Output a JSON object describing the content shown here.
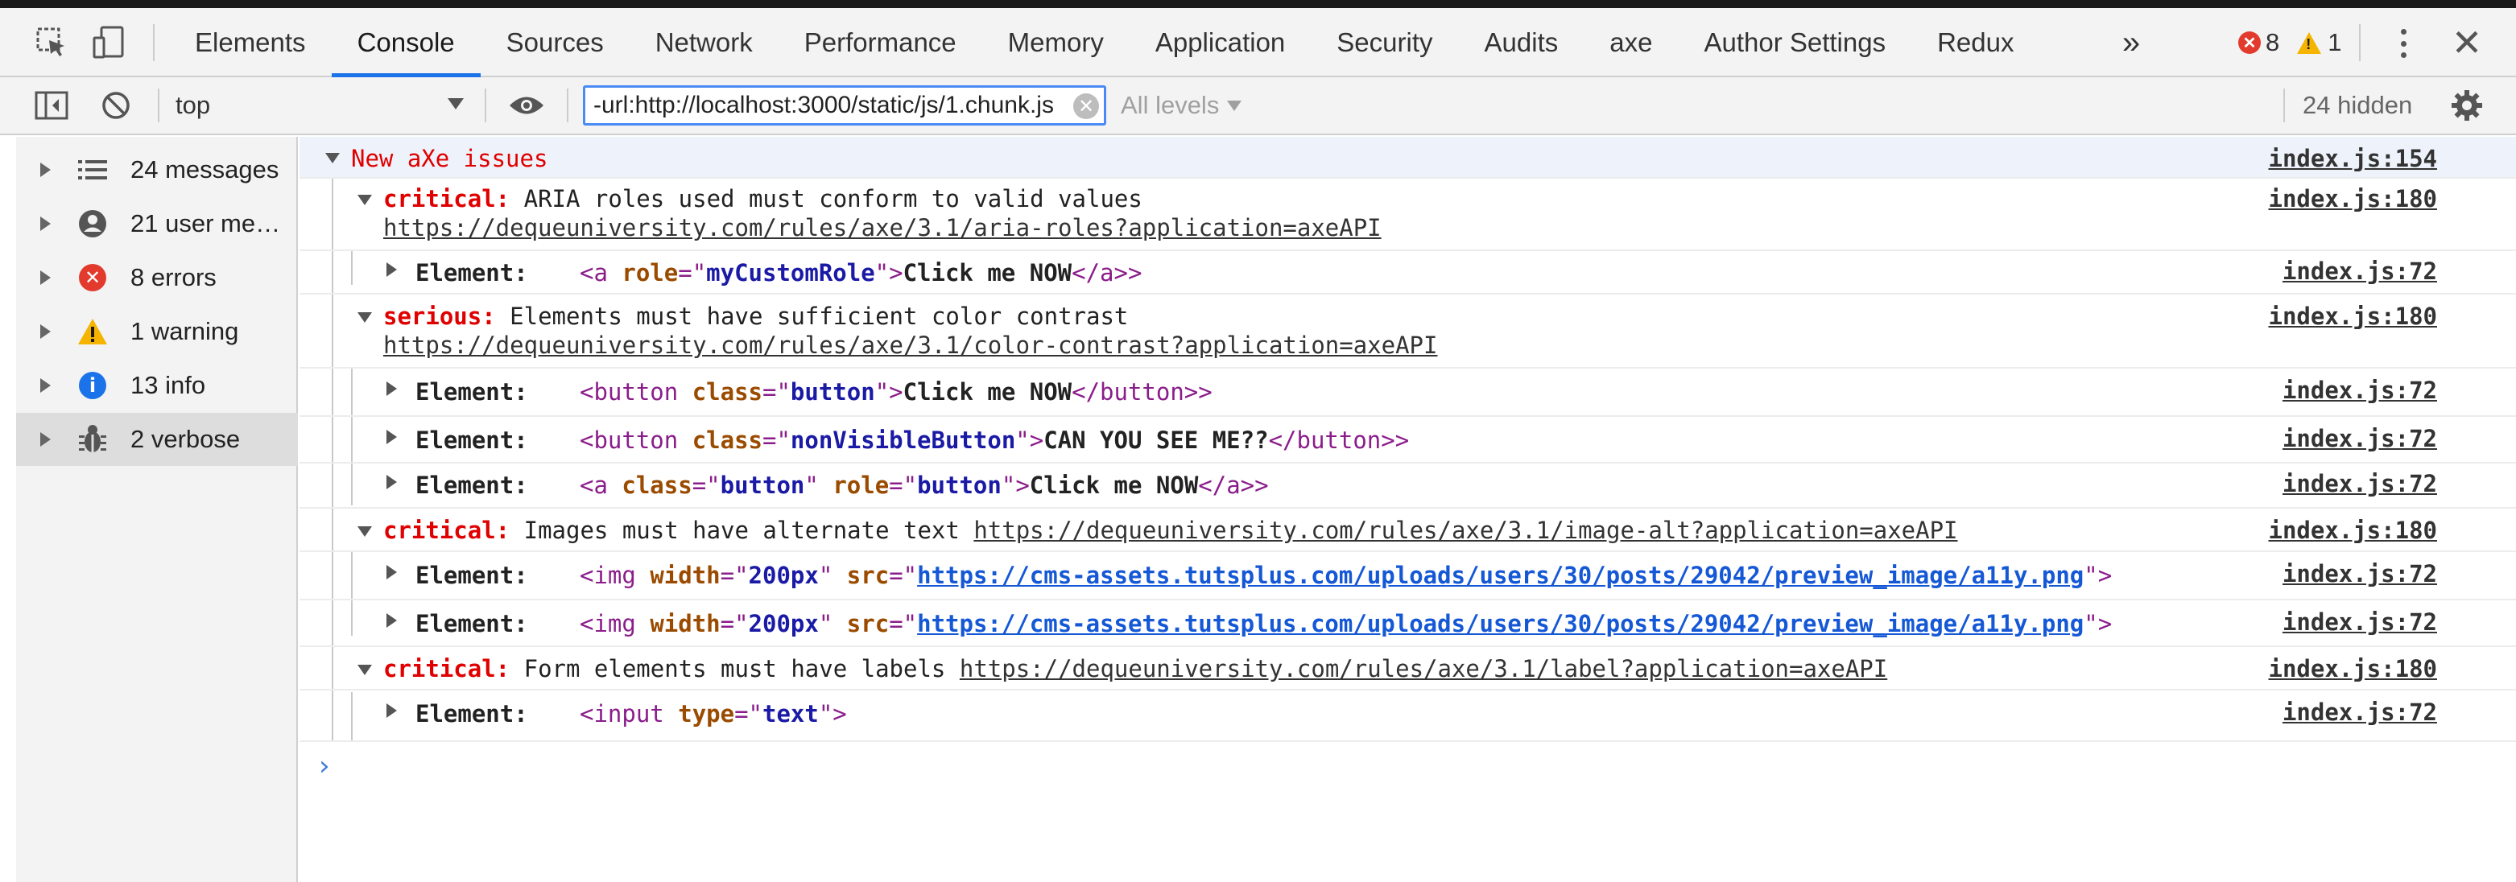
{
  "tabbar": {
    "tabs": [
      "Elements",
      "Console",
      "Sources",
      "Network",
      "Performance",
      "Memory",
      "Application",
      "Security",
      "Audits",
      "axe",
      "Author Settings",
      "Redux"
    ],
    "active_tab": "Console",
    "more_label": "»",
    "error_count": "8",
    "warning_count": "1"
  },
  "toolbar": {
    "context": "top",
    "filter_value": "-url:http://localhost:3000/static/js/1.chunk.js",
    "levels_label": "All levels",
    "hidden_label": "24 hidden"
  },
  "sidebar": {
    "items": [
      {
        "label": "24 messages",
        "icon": "list-icon"
      },
      {
        "label": "21 user me…",
        "icon": "user-icon"
      },
      {
        "label": "8 errors",
        "icon": "error-icon"
      },
      {
        "label": "1 warning",
        "icon": "warning-icon"
      },
      {
        "label": "13 info",
        "icon": "info-icon"
      },
      {
        "label": "2 verbose",
        "icon": "bug-icon"
      }
    ],
    "active_index": 5
  },
  "console": {
    "group_title": "New aXe issues",
    "group_source": "index.js:154",
    "issues": [
      {
        "severity": "critical:",
        "message": "ARIA roles used must conform to valid values",
        "help_url": "https://dequeuniversity.com/rules/axe/3.1/aria-roles?application=axeAPI",
        "source": "index.js:180",
        "elements": [
          {
            "label": "Element:",
            "open": "<a",
            "attrs": [
              {
                "name": "role",
                "value": "myCustomRole"
              }
            ],
            "text": "Click me NOW",
            "close": "</a>",
            "source": "index.js:72"
          }
        ]
      },
      {
        "severity": "serious:",
        "message": "Elements must have sufficient color contrast",
        "help_url": "https://dequeuniversity.com/rules/axe/3.1/color-contrast?application=axeAPI",
        "source": "index.js:180",
        "elements": [
          {
            "label": "Element:",
            "open": "<button",
            "attrs": [
              {
                "name": "class",
                "value": "button"
              }
            ],
            "text": "Click me NOW",
            "close": "</button>",
            "source": "index.js:72"
          },
          {
            "label": "Element:",
            "open": "<button",
            "attrs": [
              {
                "name": "class",
                "value": "nonVisibleButton"
              }
            ],
            "text": "CAN YOU SEE ME??",
            "close": "</button>",
            "source": "index.js:72"
          },
          {
            "label": "Element:",
            "open": "<a",
            "attrs": [
              {
                "name": "class",
                "value": "button"
              },
              {
                "name": "role",
                "value": "button"
              }
            ],
            "text": "Click me NOW",
            "close": "</a>",
            "source": "index.js:72"
          }
        ]
      },
      {
        "severity": "critical:",
        "message": "Images must have alternate text",
        "help_url": "https://dequeuniversity.com/rules/axe/3.1/image-alt?application=axeAPI",
        "source": "index.js:180",
        "elements": [
          {
            "label": "Element:",
            "open": "<img",
            "attrs": [
              {
                "name": "width",
                "value": "200px"
              },
              {
                "name": "src",
                "value": "https://cms-assets.tutsplus.com/uploads/users/30/posts/29042/preview_image/a11y.png",
                "is_url": true
              }
            ],
            "text": "",
            "close": "",
            "source": "index.js:72"
          },
          {
            "label": "Element:",
            "open": "<img",
            "attrs": [
              {
                "name": "width",
                "value": "200px"
              },
              {
                "name": "src",
                "value": "https://cms-assets.tutsplus.com/uploads/users/30/posts/29042/preview_image/a11y.png",
                "is_url": true
              }
            ],
            "text": "",
            "close": "",
            "source": "index.js:72"
          }
        ]
      },
      {
        "severity": "critical:",
        "message": "Form elements must have labels",
        "help_url": "https://dequeuniversity.com/rules/axe/3.1/label?application=axeAPI",
        "source": "index.js:180",
        "elements": [
          {
            "label": "Element:",
            "open": "<input",
            "attrs": [
              {
                "name": "type",
                "value": "text"
              }
            ],
            "text": "",
            "close": "",
            "source": "index.js:72"
          }
        ]
      }
    ],
    "prompt_symbol": "›"
  },
  "colors": {
    "accent": "#1a73e8",
    "error": "#e23b2e",
    "warning": "#f5b400",
    "info": "#1a73e8",
    "severity_text": "#e00000"
  }
}
